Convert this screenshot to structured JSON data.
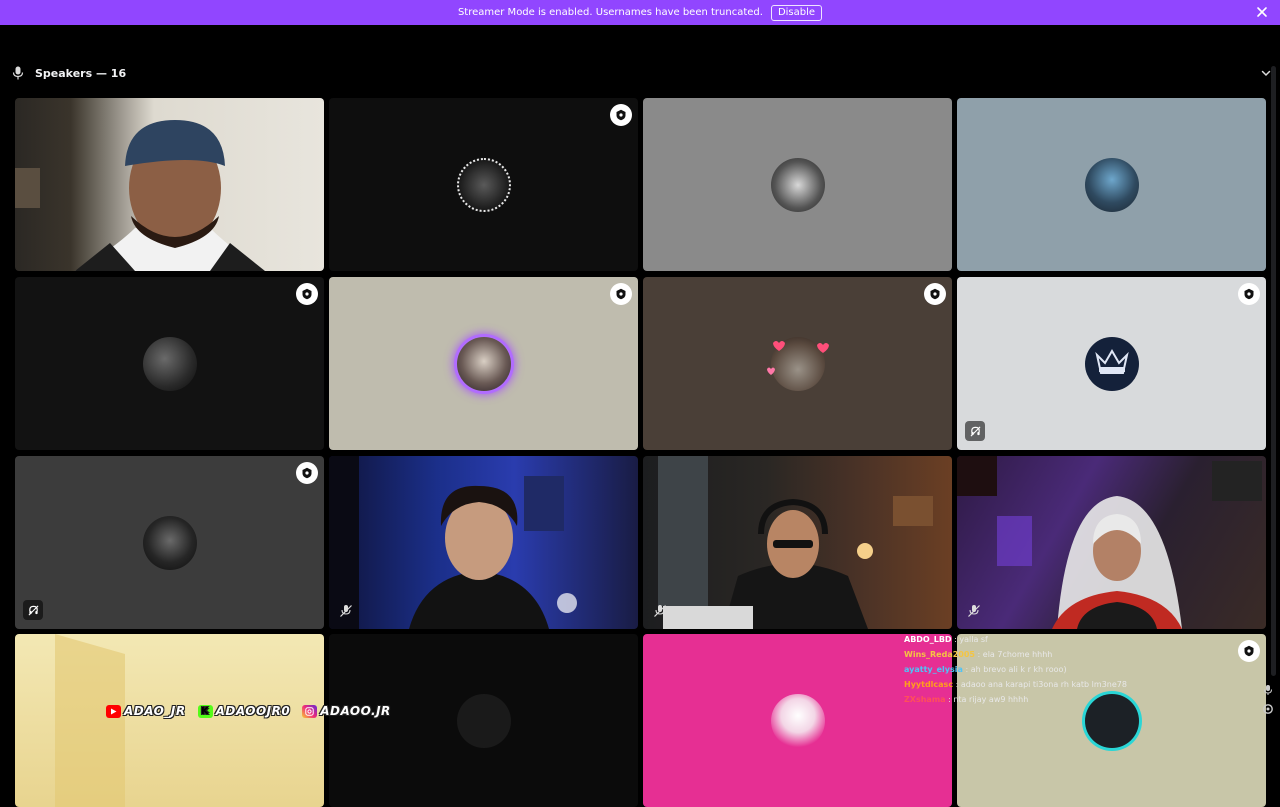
{
  "banner": {
    "message": "Streamer Mode is enabled. Usernames have been truncated.",
    "disable_label": "Disable",
    "color": "#9146ff"
  },
  "speakers": {
    "title": "Speakers — 16"
  },
  "tiles": [
    {
      "row": 1,
      "col": 1,
      "kind": "camera",
      "background": "#d8d4ca",
      "moderator_badge": false
    },
    {
      "row": 1,
      "col": 2,
      "kind": "avatar",
      "background": "#0e0e0e",
      "moderator_badge": true
    },
    {
      "row": 1,
      "col": 3,
      "kind": "avatar",
      "background": "#8a8a8a",
      "moderator_badge": false
    },
    {
      "row": 1,
      "col": 4,
      "kind": "avatar",
      "background": "#8fa0aa",
      "moderator_badge": false
    },
    {
      "row": 2,
      "col": 1,
      "kind": "avatar",
      "background": "#121212",
      "moderator_badge": true
    },
    {
      "row": 2,
      "col": 2,
      "kind": "avatar",
      "background": "#bfbcae",
      "moderator_badge": true,
      "speaking": true
    },
    {
      "row": 2,
      "col": 3,
      "kind": "avatar",
      "background": "#4a3f37",
      "moderator_badge": true
    },
    {
      "row": 2,
      "col": 4,
      "kind": "avatar",
      "background": "#d8dadc",
      "moderator_badge": true,
      "status_icon": "deafened-icon"
    },
    {
      "row": 3,
      "col": 1,
      "kind": "avatar",
      "background": "#3c3c3c",
      "moderator_badge": true,
      "status_icon": "deafened-icon"
    },
    {
      "row": 3,
      "col": 2,
      "kind": "camera",
      "background": "#1a1d55",
      "moderator_badge": false,
      "status_icon": "muted-icon"
    },
    {
      "row": 3,
      "col": 3,
      "kind": "camera",
      "background": "#2c2622",
      "moderator_badge": false,
      "status_icon": "muted-icon"
    },
    {
      "row": 3,
      "col": 4,
      "kind": "camera",
      "background": "#2a1d3a",
      "moderator_badge": false,
      "status_icon": "muted-icon"
    },
    {
      "row": 4,
      "col": 1,
      "kind": "camera",
      "background": "#eee0a0",
      "moderator_badge": false
    },
    {
      "row": 4,
      "col": 2,
      "kind": "avatar",
      "background": "#0b0b0b",
      "moderator_badge": false
    },
    {
      "row": 4,
      "col": 3,
      "kind": "avatar",
      "background": "#e62f93",
      "moderator_badge": false
    },
    {
      "row": 4,
      "col": 4,
      "kind": "avatar",
      "background": "#c8c6a8",
      "moderator_badge": true
    }
  ],
  "chat": [
    {
      "user": "ABDO_LBD",
      "separator": " : ",
      "message": "yalla sf",
      "color": "#ffffff"
    },
    {
      "user": "Wins_Reda2005",
      "separator": " : ",
      "message": "ela 7chome hhhh",
      "color": "#f4c542"
    },
    {
      "user": "ayatty_elysia",
      "separator": " : ",
      "message": "ah brevo ali k r kh rooo)",
      "color": "#4fc3f7"
    },
    {
      "user": "Hyytdlcasc",
      "separator": " : ",
      "message": "adaoo ana karapi ti3ona rh katb lm3ne78",
      "color": "#ff9f1c"
    },
    {
      "user": "ZXshama",
      "separator": " : ",
      "message": "nta rijay aw9 hhhh",
      "color": "#ff4f5a"
    }
  ],
  "socials": [
    {
      "platform": "youtube-icon",
      "handle": "ADAO_JR",
      "color": "#ff0000"
    },
    {
      "platform": "kick-icon",
      "handle": "ADAOOJR0",
      "color": "#53fc18"
    },
    {
      "platform": "instagram-icon",
      "handle": "ADAOO.JR",
      "color": "#d6249f"
    }
  ]
}
